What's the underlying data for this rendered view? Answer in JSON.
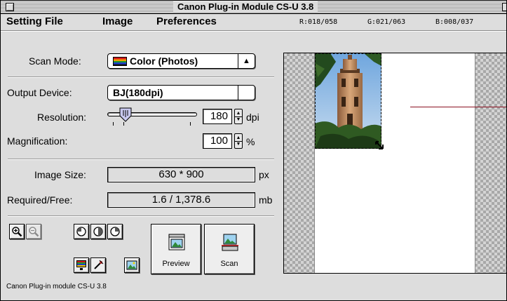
{
  "window": {
    "title": "Canon Plug-in Module CS-U 3.8"
  },
  "menubar": {
    "items": [
      "Setting File",
      "Image",
      "Preferences"
    ],
    "readout": {
      "r": "R:018/058",
      "g": "G:021/063",
      "b": "B:008/037"
    }
  },
  "scan_mode": {
    "label": "Scan Mode:",
    "value": "Color (Photos)",
    "icon": "color-bars-icon"
  },
  "output_device": {
    "label": "Output Device:",
    "value": "BJ(180dpi)"
  },
  "resolution": {
    "label": "Resolution:",
    "value": "180",
    "unit": "dpi",
    "slider_level": 0.15
  },
  "magnification": {
    "label": "Magnification:",
    "value": "100",
    "unit": "%"
  },
  "image_size": {
    "label": "Image Size:",
    "value": "630 * 900",
    "unit": "px"
  },
  "required_free": {
    "label": "Required/Free:",
    "value": "1.6 / 1,378.6",
    "unit": "mb"
  },
  "tools": {
    "icons": [
      "zoom-in-icon",
      "zoom-out-icon",
      "rotate-left-icon",
      "flip-icon",
      "rotate-right-icon",
      "color-adjust-icon",
      "eyedropper-icon",
      "picture-icon"
    ],
    "preview_label": "Preview",
    "scan_label": "Scan"
  },
  "status": {
    "text": "Canon Plug-in module CS-U 3.8"
  },
  "colors": {
    "window_bg": "#dddddd",
    "marker_line": "#8a1020"
  }
}
